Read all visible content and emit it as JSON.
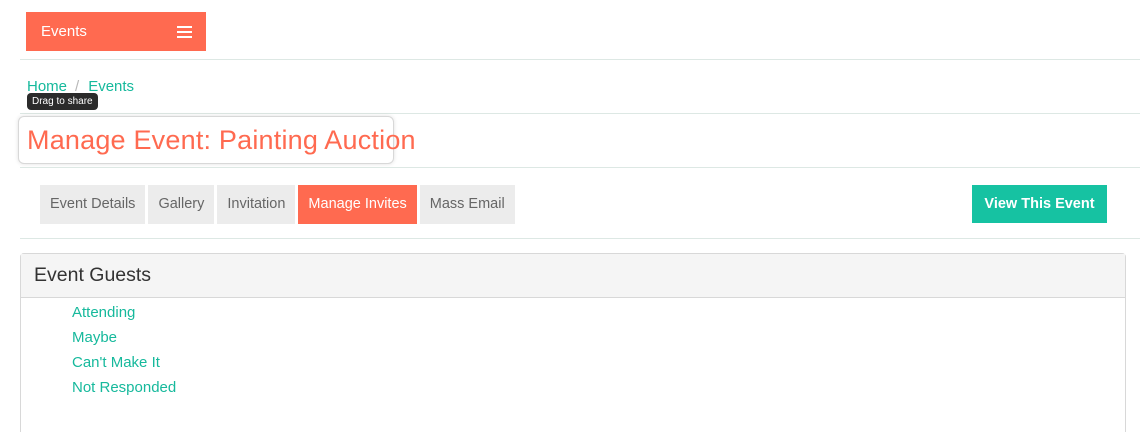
{
  "topbar": {
    "label": "Events",
    "menu_icon": "hamburger-menu-icon",
    "accent_color": "#ff6a50"
  },
  "breadcrumb": {
    "items": [
      {
        "label": "Home"
      },
      {
        "label": "Events"
      }
    ],
    "separator": "/"
  },
  "tooltip": {
    "text": "Drag to share"
  },
  "page": {
    "title": "Manage Event: Painting Auction"
  },
  "tabs": [
    {
      "label": "Event Details",
      "active": false
    },
    {
      "label": "Gallery",
      "active": false
    },
    {
      "label": "Invitation",
      "active": false
    },
    {
      "label": "Manage Invites",
      "active": true
    },
    {
      "label": "Mass Email",
      "active": false
    }
  ],
  "actions": {
    "view_event_label": "View This Event",
    "view_event_color": "#16c2a2"
  },
  "guests_panel": {
    "title": "Event Guests",
    "links": [
      {
        "label": "Attending"
      },
      {
        "label": "Maybe"
      },
      {
        "label": "Can't Make It"
      },
      {
        "label": "Not Responded"
      }
    ],
    "link_color": "#16b99c"
  }
}
